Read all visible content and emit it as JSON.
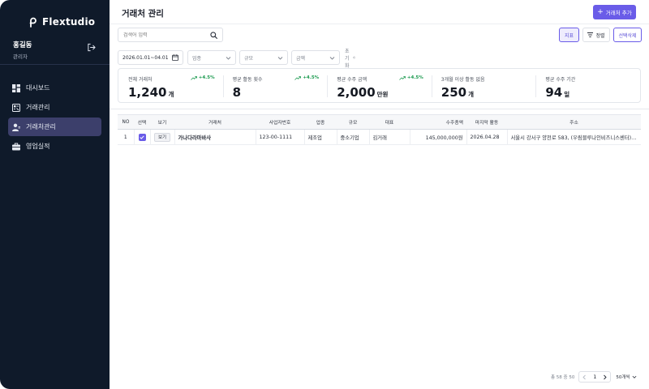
{
  "sidebar": {
    "brand": "Flextudio",
    "user_name": "홍길동",
    "user_role": "관리자",
    "items": [
      {
        "label": "대시보드",
        "icon": "dashboard-icon"
      },
      {
        "label": "거래관리",
        "icon": "deal-icon"
      },
      {
        "label": "거래처관리",
        "icon": "client-icon"
      },
      {
        "label": "영업실적",
        "icon": "briefcase-icon"
      }
    ],
    "active_index": 2
  },
  "header": {
    "title": "거래처 관리",
    "add_label": "거래처 추가"
  },
  "toolbar": {
    "search_placeholder": "검색어 입력",
    "data_label": "지표",
    "sort_label": "정렬",
    "delete_label": "선택삭제"
  },
  "filters": {
    "date_range": "2026.01.01~04.01",
    "industry": "업종",
    "size": "규모",
    "amount": "금액",
    "reset": "초기화"
  },
  "stats": [
    {
      "label": "전체 거래처",
      "value": "1,240",
      "unit": "개",
      "trend": "+4.5%"
    },
    {
      "label": "평균 활동 횟수",
      "value": "8",
      "unit": "",
      "trend": "+4.5%"
    },
    {
      "label": "평균 수주 금액",
      "value": "2,000",
      "unit": "만원",
      "trend": "+4.5%"
    },
    {
      "label": "3개월 이상 활동 없음",
      "value": "250",
      "unit": "개",
      "trend": ""
    },
    {
      "label": "평균 수주 기간",
      "value": "94",
      "unit": "일",
      "trend": ""
    }
  ],
  "table": {
    "columns": [
      "NO",
      "선택",
      "보기",
      "거래처",
      "사업자번호",
      "업종",
      "규모",
      "대표",
      "수주총액",
      "마지막 활동",
      "주소"
    ],
    "rows": [
      {
        "no": "1",
        "checked": true,
        "view": "보기",
        "name": "가나다라마바사",
        "biz_no": "123-00-1111",
        "industry": "제조업",
        "size": "중소기업",
        "ceo": "김거래",
        "total": "145,000,000원",
        "last_activity": "2026.04.28",
        "address": "서울시 강서구 양천로 583, (우림블루나인비즈니스센터) A동 1층"
      }
    ]
  },
  "pagination": {
    "total_text": "총 58 중 50",
    "page": "1",
    "per_page": "50개씩"
  },
  "colors": {
    "sidebar_bg": "#0f1a2a",
    "accent": "#6a5ce8",
    "trend_up": "#1b9a4f"
  }
}
